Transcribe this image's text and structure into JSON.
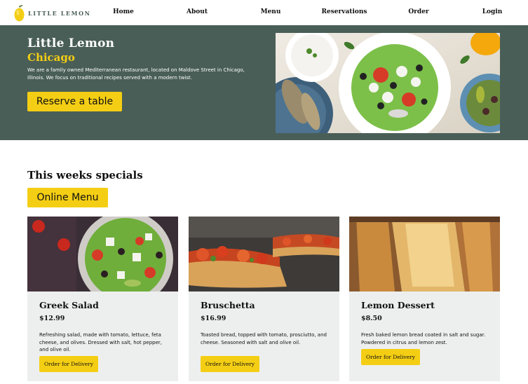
{
  "brand": {
    "name": "Little Lemon",
    "logo_icon": "lemon-icon",
    "colors": {
      "primary_green": "#495e57",
      "primary_yellow": "#f4ce14",
      "card_bg": "#edefee"
    }
  },
  "nav": {
    "items": [
      {
        "label": "Home"
      },
      {
        "label": "About"
      },
      {
        "label": "Menu"
      },
      {
        "label": "Reservations"
      },
      {
        "label": "Order"
      },
      {
        "label": "Login"
      }
    ]
  },
  "hero": {
    "title": "Little Lemon",
    "subtitle": "Chicago",
    "description": "We are a family owned Mediterranean restaurant, located on Maldove Street in Chicago, Illinois. We focus on traditional recipes served with a modern twist.",
    "button_label": "Reserve a table"
  },
  "specials": {
    "title": "This weeks specials",
    "menu_button_label": "Online Menu",
    "items": [
      {
        "name": "Greek Salad",
        "price": "$12.99",
        "description": "Refreshing salad, made with tomato, lettuce, feta cheese, and olives. Dressed with salt, hot pepper, and olive oil.",
        "button_label": "Order for Delivery"
      },
      {
        "name": "Bruschetta",
        "price": "$16.99",
        "description": "Toasted bread, topped with tomato, prosciutto, and cheese. Seasoned with salt and olive oil.",
        "button_label": "Order for Delivery"
      },
      {
        "name": "Lemon Dessert",
        "price": "$8.50",
        "description": "Fresh baked lemon bread coated in salt and sugar. Powdered in citrus and lemon zest.",
        "button_label": "Order for Delivery"
      }
    ]
  }
}
